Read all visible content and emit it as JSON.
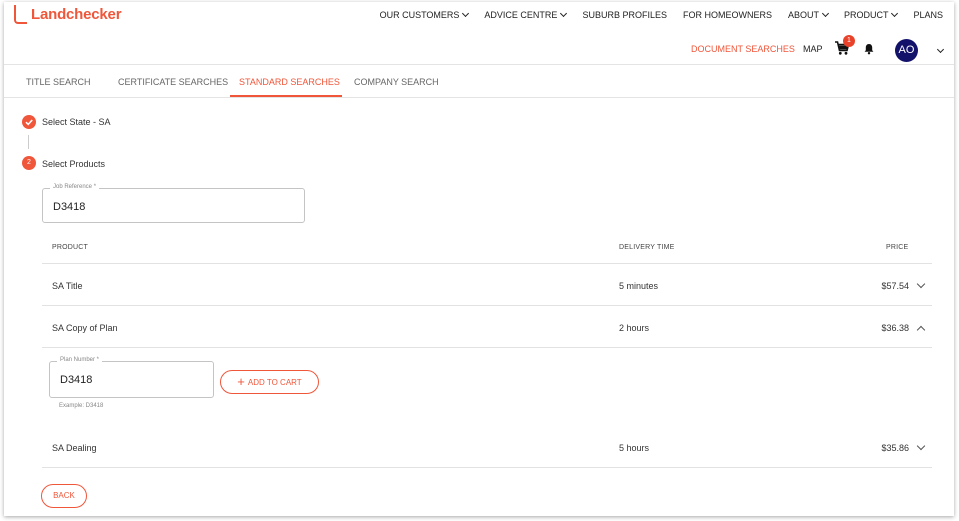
{
  "brand": {
    "name": "Landchecker",
    "color": "#f0563a"
  },
  "nav": {
    "items": [
      {
        "label": "OUR CUSTOMERS",
        "dropdown": true
      },
      {
        "label": "ADVICE CENTRE",
        "dropdown": true
      },
      {
        "label": "SUBURB PROFILES",
        "dropdown": false
      },
      {
        "label": "FOR HOMEOWNERS",
        "dropdown": false
      },
      {
        "label": "ABOUT",
        "dropdown": true
      },
      {
        "label": "PRODUCT",
        "dropdown": true
      },
      {
        "label": "PLANS",
        "dropdown": false
      }
    ]
  },
  "subnav": {
    "document_searches": "DOCUMENT SEARCHES",
    "map": "MAP",
    "cart_count": "1",
    "cart_icon": "cart-icon",
    "bell_icon": "bell-icon",
    "avatar_initials": "AO",
    "avatar_color": "#12126b"
  },
  "tabs": [
    {
      "label": "TITLE SEARCH",
      "active": false
    },
    {
      "label": "CERTIFICATE SEARCHES",
      "active": false
    },
    {
      "label": "STANDARD SEARCHES",
      "active": true
    },
    {
      "label": "COMPANY SEARCH",
      "active": false
    }
  ],
  "steps": [
    {
      "marker": "check-icon",
      "label": "Select State - SA"
    },
    {
      "marker": "2",
      "label": "Select Products"
    }
  ],
  "job_reference": {
    "label": "Job Reference *",
    "value": "D3418"
  },
  "table": {
    "headers": {
      "product": "PRODUCT",
      "delivery": "DELIVERY TIME",
      "price": "PRICE"
    },
    "rows": [
      {
        "product": "SA Title",
        "delivery": "5 minutes",
        "price": "$57.54",
        "expanded": false
      },
      {
        "product": "SA Copy of Plan",
        "delivery": "2 hours",
        "price": "$36.38",
        "expanded": true
      },
      {
        "product": "SA Dealing",
        "delivery": "5 hours",
        "price": "$35.86",
        "expanded": false
      }
    ]
  },
  "plan_number": {
    "label": "Plan Number *",
    "value": "D3418",
    "helper": "Example: D3418",
    "add_to_cart": "ADD TO CART"
  },
  "back_label": "BACK"
}
